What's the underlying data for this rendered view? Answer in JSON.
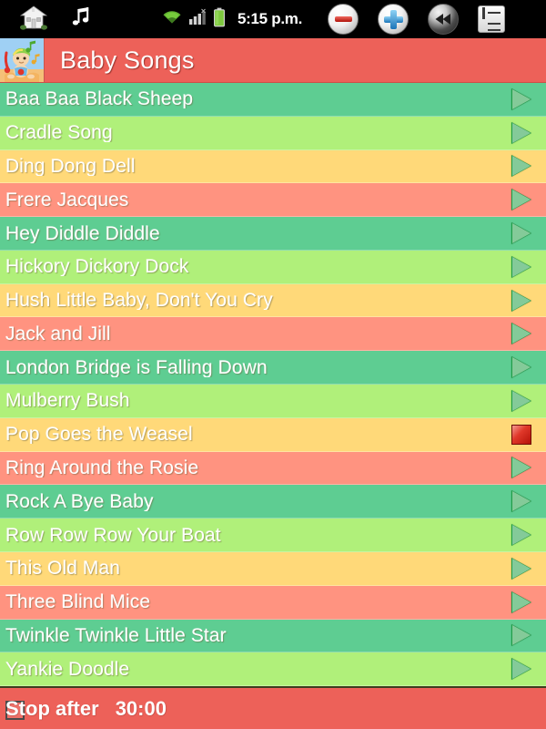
{
  "status_bar": {
    "home_icon": "home-icon",
    "music_icon": "music-note-icon",
    "wifi_icon": "wifi-icon",
    "signal_icon": "cell-signal-icon",
    "battery_icon": "battery-icon",
    "time": "5:15 p.m.",
    "minus_button": "minus-circle-icon",
    "plus_button": "plus-circle-icon",
    "rewind_button": "rewind-circle-icon",
    "playlist_button": "playlist-icon"
  },
  "title_bar": {
    "app_icon": "baby-songs-app-icon",
    "title": "Baby Songs"
  },
  "colors": {
    "header": "#ed6159",
    "row_teal": "#5ecd92",
    "row_green": "#b0f07a",
    "row_gold": "#ffd979",
    "row_salmon": "#ff9380",
    "play_icon": "#1f9e46",
    "stop_icon": "#c41b0e",
    "status_bar": "#000000",
    "text": "#ffffff"
  },
  "songs": [
    {
      "title": "Baa Baa Black Sheep",
      "color": 0,
      "action": "play"
    },
    {
      "title": "Cradle Song",
      "color": 1,
      "action": "play"
    },
    {
      "title": "Ding Dong Dell",
      "color": 2,
      "action": "play"
    },
    {
      "title": "Frere Jacques",
      "color": 3,
      "action": "play"
    },
    {
      "title": "Hey Diddle Diddle",
      "color": 0,
      "action": "play"
    },
    {
      "title": "Hickory Dickory Dock",
      "color": 1,
      "action": "play"
    },
    {
      "title": "Hush Little Baby, Don't You Cry",
      "color": 2,
      "action": "play"
    },
    {
      "title": "Jack and Jill",
      "color": 3,
      "action": "play"
    },
    {
      "title": "London Bridge is Falling Down",
      "color": 0,
      "action": "play"
    },
    {
      "title": "Mulberry Bush",
      "color": 1,
      "action": "play"
    },
    {
      "title": "Pop Goes the Weasel",
      "color": 2,
      "action": "stop"
    },
    {
      "title": "Ring Around the Rosie",
      "color": 3,
      "action": "play"
    },
    {
      "title": "Rock A Bye Baby",
      "color": 0,
      "action": "play"
    },
    {
      "title": "Row Row Row Your Boat",
      "color": 1,
      "action": "play"
    },
    {
      "title": "This Old Man",
      "color": 2,
      "action": "play"
    },
    {
      "title": "Three Blind Mice",
      "color": 3,
      "action": "play"
    },
    {
      "title": "Twinkle Twinkle Little Star",
      "color": 0,
      "action": "play"
    },
    {
      "title": "Yankie Doodle",
      "color": 1,
      "action": "play"
    }
  ],
  "footer": {
    "stop_after_label": "Stop after",
    "stop_after_time": "30:00",
    "checkbox_checked": false
  }
}
